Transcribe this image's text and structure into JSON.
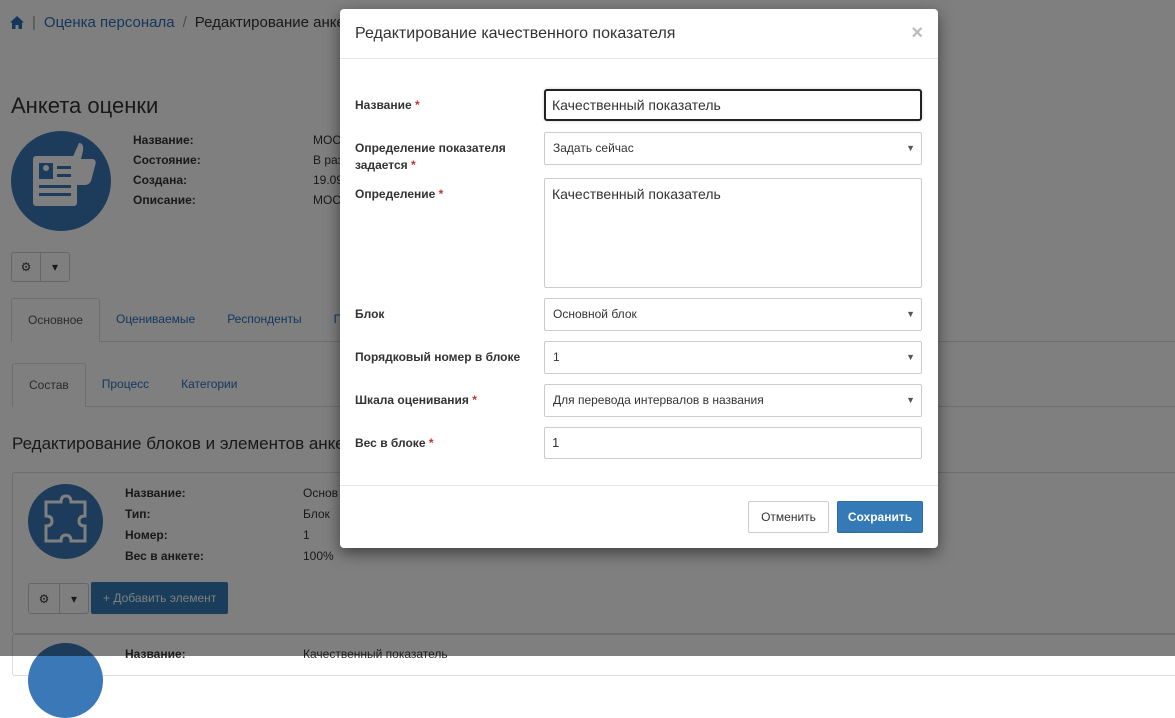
{
  "breadcrumb": {
    "items": [
      "Оценка персонала"
    ],
    "current": "Редактирование анкет"
  },
  "page": {
    "title": "Анкета оценки",
    "info": [
      {
        "label": "Название:",
        "value": "МОС"
      },
      {
        "label": "Состояние:",
        "value": "В раз"
      },
      {
        "label": "Создана:",
        "value": "19.09"
      },
      {
        "label": "Описание:",
        "value": "МОС"
      }
    ],
    "tabs": [
      "Основное",
      "Оцениваемые",
      "Респонденты",
      "П"
    ],
    "subtabs": [
      "Состав",
      "Процесс",
      "Категории"
    ],
    "section_title": "Редактирование блоков и элементов анке",
    "block": {
      "info": [
        {
          "label": "Название:",
          "value": "Основ"
        },
        {
          "label": "Тип:",
          "value": "Блок"
        },
        {
          "label": "Номер:",
          "value": "1"
        },
        {
          "label": "Вес в анкете:",
          "value": "100%"
        }
      ],
      "add_button": "Добавить элемент"
    },
    "element": {
      "label": "Название:",
      "value": "Качественный показатель"
    }
  },
  "modal": {
    "title": "Редактирование качественного показателя",
    "close": "×",
    "fields": {
      "name": {
        "label": "Название",
        "value": "Качественный показатель"
      },
      "definition_set": {
        "label": "Определение показателя задается",
        "value": "Задать сейчас"
      },
      "definition": {
        "label": "Определение",
        "value": "Качественный показатель"
      },
      "block": {
        "label": "Блок",
        "value": "Основной блок"
      },
      "order": {
        "label": "Порядковый номер в блоке",
        "value": "1"
      },
      "scale": {
        "label": "Шкала оценивания",
        "value": "Для перевода интервалов в названия"
      },
      "weight": {
        "label": "Вес в блоке",
        "value": "1"
      }
    },
    "required_mark": "*",
    "buttons": {
      "cancel": "Отменить",
      "save": "Сохранить"
    }
  },
  "colors": {
    "accent": "#337ab7",
    "link": "#2a6ebb",
    "required": "#c9302c",
    "icon_bg": "#3a78b8"
  }
}
